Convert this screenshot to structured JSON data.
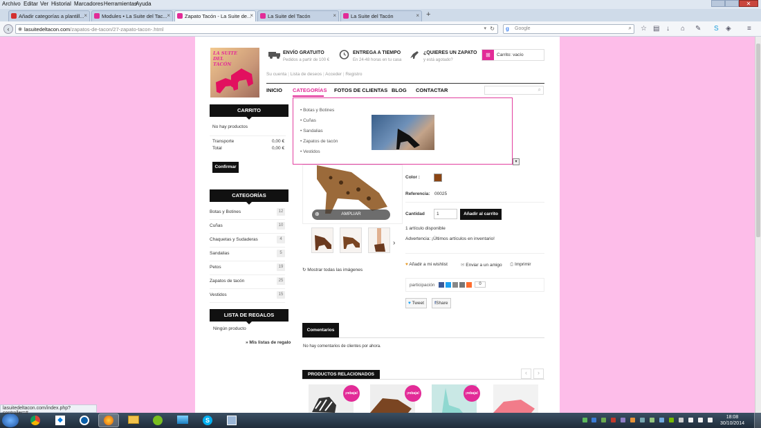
{
  "menu": [
    "Archivo",
    "Editar",
    "Ver",
    "Historial",
    "Marcadores",
    "Herramientas",
    "Ayuda"
  ],
  "tabs": [
    {
      "label": "Añadir categorías a plantill...",
      "color": "#d32f2f"
    },
    {
      "label": "Modules • La Suite del Tac...",
      "color": "#e22b97"
    },
    {
      "label": "Zapato Tacón - La Suite de...",
      "color": "#e22b97"
    },
    {
      "label": "La Suite del Tacón",
      "color": "#e22b97"
    },
    {
      "label": "La Suite del Tacón",
      "color": "#e22b97"
    }
  ],
  "address": {
    "domain": "lasuitedeltacon.com",
    "path": "/zapatos-de-tacon/27-zapato-tacon-.html",
    "search_placeholder": "Google"
  },
  "header": {
    "logo_text": "LA SUITE DEL TACÓN",
    "features": [
      {
        "title": "ENVÍO GRATUITO",
        "sub": "Pedidos a partir de 100 €",
        "icon": "truck-icon"
      },
      {
        "title": "ENTREGA A TIEMPO",
        "sub": "En 24-48 horas en tu casa",
        "icon": "clock-icon"
      },
      {
        "title": "¿QUIERES UN ZAPATO",
        "sub": "y está agotado?",
        "icon": "shoe-icon"
      }
    ],
    "cart_label": "Carrito: vacío",
    "user_links": [
      "Su cuenta",
      "Lista de deseos",
      "Acceder",
      "Registro"
    ]
  },
  "nav": [
    "INICIO",
    "CATEGORÍAS",
    "FOTOS DE CLIENTAS",
    "BLOG",
    "CONTACTAR"
  ],
  "dropdown": [
    "Botas y Botines",
    "Cuñas",
    "Sandalias",
    "Zapatos de tacón",
    "Vestidos"
  ],
  "sidebar": {
    "cart_title": "CARRITO",
    "cart_empty": "No hay productos",
    "transport_label": "Transporte",
    "transport_value": "0,00 €",
    "total_label": "Total",
    "total_value": "0,00 €",
    "confirm": "Confirmar",
    "categories_title": "CATEGORÍAS",
    "categories": [
      {
        "name": "Botas y Botines",
        "count": "12"
      },
      {
        "name": "Cuñas",
        "count": "10"
      },
      {
        "name": "Chaquetas y Sudaderas",
        "count": "4"
      },
      {
        "name": "Sandalias",
        "count": "5"
      },
      {
        "name": "Petos",
        "count": "19"
      },
      {
        "name": "Zapatos de tacón",
        "count": "25"
      },
      {
        "name": "Vestidos",
        "count": "15"
      }
    ],
    "gifts_title": "LISTA DE REGALOS",
    "gifts_empty": "Ningún producto",
    "gifts_link": "» Mis listas de regalo"
  },
  "product": {
    "zoom": "AMPLIAR",
    "show_all": "Mostrar todas las imágenes",
    "color_label": "Color :",
    "ref_label": "Referencia:",
    "ref_value": "00025",
    "qty_label": "Cantidad",
    "qty_value": "1",
    "add_cart": "Añadir al carrito",
    "available": "1 artículo disponible",
    "warning": "Advertencia: ¡Últimos artículos en inventario!",
    "wishlist": "Añadir a mi wishlist",
    "send_friend": "Enviar a un amigo",
    "print": "Imprimir",
    "share_label": "participación",
    "share_count": "0",
    "tweet": "Tweet",
    "fshare": "Share",
    "swatch": "#8b4513"
  },
  "comments": {
    "title": "Comentarios",
    "empty": "No hay comentarios de clientes por ahora."
  },
  "related": {
    "title": "PRODUCTOS RELACIONADOS",
    "badge": "¡rebaja!"
  },
  "status_text": "lasuitedeltacon.com/index.php?controller=#",
  "clock": {
    "time": "18:08",
    "date": "30/10/2014"
  },
  "colors": {
    "page_bg": "#fdbde9",
    "accent": "#e22b97",
    "dropdown_border": "#e23d9e"
  }
}
